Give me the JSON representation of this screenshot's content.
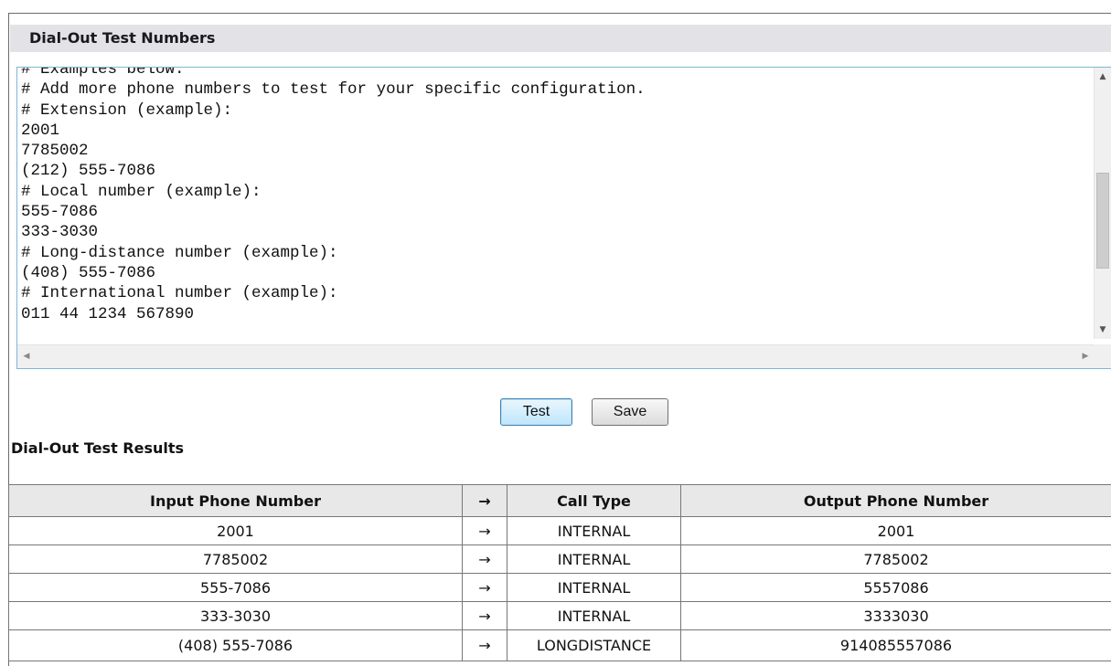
{
  "section_title": "Dial-Out Test Numbers",
  "textarea": {
    "lines": [
      "# Examples below.",
      "# Add more phone numbers to test for your specific configuration.",
      "# Extension (example):",
      "2001",
      "7785002",
      "(212) 555-7086",
      "# Local number (example):",
      "555-7086",
      "333-3030",
      "# Long-distance number (example):",
      "(408) 555-7086",
      "# International number (example):",
      "011 44 1234 567890"
    ]
  },
  "buttons": {
    "test": "Test",
    "save": "Save"
  },
  "results_title": "Dial-Out Test Results",
  "results_table": {
    "headers": [
      "Input Phone Number",
      "→",
      "Call Type",
      "Output Phone Number"
    ],
    "rows": [
      [
        "2001",
        "→",
        "INTERNAL",
        "2001"
      ],
      [
        "7785002",
        "→",
        "INTERNAL",
        "7785002"
      ],
      [
        "555-7086",
        "→",
        "INTERNAL",
        "5557086"
      ],
      [
        "333-3030",
        "→",
        "INTERNAL",
        "3333030"
      ],
      [
        "(408) 555-7086",
        "→",
        "LONGDISTANCE",
        "914085557086"
      ]
    ]
  },
  "icons": {
    "scroll_up": "scroll-up-arrow-icon",
    "scroll_down": "scroll-down-arrow-icon",
    "scroll_left": "scroll-left-arrow-icon",
    "scroll_right": "scroll-right-arrow-icon"
  },
  "colors": {
    "header_bg": "#e3e3e7",
    "textbox_border": "#7eb6d6",
    "table_header_bg": "#e8e8e8"
  }
}
